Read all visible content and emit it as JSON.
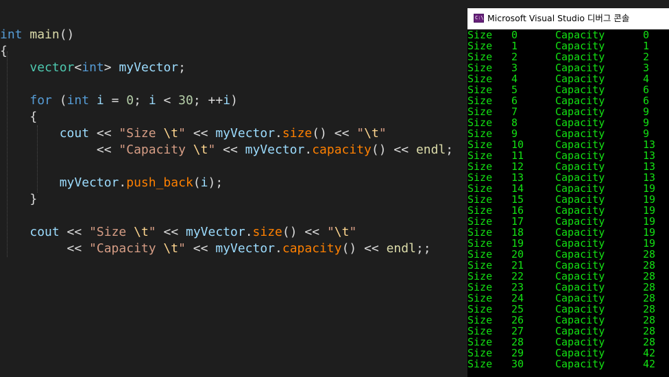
{
  "editor": {
    "lines": [
      [
        {
          "t": "int",
          "c": "kw"
        },
        {
          "t": " ",
          "c": "plain"
        },
        {
          "t": "main",
          "c": "fn"
        },
        {
          "t": "()",
          "c": "plain"
        }
      ],
      [
        {
          "t": "{",
          "c": "plain"
        }
      ],
      [
        {
          "t": "    ",
          "c": "plain"
        },
        {
          "t": "vector",
          "c": "type"
        },
        {
          "t": "<",
          "c": "plain"
        },
        {
          "t": "int",
          "c": "kw"
        },
        {
          "t": "> ",
          "c": "plain"
        },
        {
          "t": "myVector",
          "c": "var"
        },
        {
          "t": ";",
          "c": "plain"
        }
      ],
      [],
      [
        {
          "t": "    ",
          "c": "plain"
        },
        {
          "t": "for",
          "c": "kw"
        },
        {
          "t": " (",
          "c": "plain"
        },
        {
          "t": "int",
          "c": "kw"
        },
        {
          "t": " ",
          "c": "plain"
        },
        {
          "t": "i",
          "c": "var"
        },
        {
          "t": " = ",
          "c": "plain"
        },
        {
          "t": "0",
          "c": "num"
        },
        {
          "t": "; ",
          "c": "plain"
        },
        {
          "t": "i",
          "c": "var"
        },
        {
          "t": " < ",
          "c": "plain"
        },
        {
          "t": "30",
          "c": "num"
        },
        {
          "t": "; ++",
          "c": "plain"
        },
        {
          "t": "i",
          "c": "var"
        },
        {
          "t": ")",
          "c": "plain"
        }
      ],
      [
        {
          "t": "    {",
          "c": "plain"
        }
      ],
      [
        {
          "t": "        ",
          "c": "plain"
        },
        {
          "t": "cout",
          "c": "var"
        },
        {
          "t": " << ",
          "c": "plain"
        },
        {
          "t": "\"Size ",
          "c": "str"
        },
        {
          "t": "\\t",
          "c": "esc"
        },
        {
          "t": "\"",
          "c": "str"
        },
        {
          "t": " << ",
          "c": "plain"
        },
        {
          "t": "myVector",
          "c": "var"
        },
        {
          "t": ".",
          "c": "plain"
        },
        {
          "t": "size",
          "c": "mem"
        },
        {
          "t": "() << ",
          "c": "plain"
        },
        {
          "t": "\"",
          "c": "str"
        },
        {
          "t": "\\t",
          "c": "esc"
        },
        {
          "t": "\"",
          "c": "str"
        }
      ],
      [
        {
          "t": "             << ",
          "c": "plain"
        },
        {
          "t": "\"Capacity ",
          "c": "str"
        },
        {
          "t": "\\t",
          "c": "esc"
        },
        {
          "t": "\"",
          "c": "str"
        },
        {
          "t": " << ",
          "c": "plain"
        },
        {
          "t": "myVector",
          "c": "var"
        },
        {
          "t": ".",
          "c": "plain"
        },
        {
          "t": "capacity",
          "c": "mem"
        },
        {
          "t": "() << ",
          "c": "plain"
        },
        {
          "t": "endl",
          "c": "fn"
        },
        {
          "t": ";",
          "c": "plain"
        }
      ],
      [],
      [
        {
          "t": "        ",
          "c": "plain"
        },
        {
          "t": "myVector",
          "c": "var"
        },
        {
          "t": ".",
          "c": "plain"
        },
        {
          "t": "push_back",
          "c": "mem"
        },
        {
          "t": "(",
          "c": "plain"
        },
        {
          "t": "i",
          "c": "var"
        },
        {
          "t": ");",
          "c": "plain"
        }
      ],
      [
        {
          "t": "    }",
          "c": "plain"
        }
      ],
      [],
      [
        {
          "t": "    ",
          "c": "plain"
        },
        {
          "t": "cout",
          "c": "var"
        },
        {
          "t": " << ",
          "c": "plain"
        },
        {
          "t": "\"Size ",
          "c": "str"
        },
        {
          "t": "\\t",
          "c": "esc"
        },
        {
          "t": "\"",
          "c": "str"
        },
        {
          "t": " << ",
          "c": "plain"
        },
        {
          "t": "myVector",
          "c": "var"
        },
        {
          "t": ".",
          "c": "plain"
        },
        {
          "t": "size",
          "c": "mem"
        },
        {
          "t": "() << ",
          "c": "plain"
        },
        {
          "t": "\"",
          "c": "str"
        },
        {
          "t": "\\t",
          "c": "esc"
        },
        {
          "t": "\"",
          "c": "str"
        }
      ],
      [
        {
          "t": "         << ",
          "c": "plain"
        },
        {
          "t": "\"Capacity ",
          "c": "str"
        },
        {
          "t": "\\t",
          "c": "esc"
        },
        {
          "t": "\"",
          "c": "str"
        },
        {
          "t": " << ",
          "c": "plain"
        },
        {
          "t": "myVector",
          "c": "var"
        },
        {
          "t": ".",
          "c": "plain"
        },
        {
          "t": "capacity",
          "c": "mem"
        },
        {
          "t": "() << ",
          "c": "plain"
        },
        {
          "t": "endl",
          "c": "fn"
        },
        {
          "t": ";;",
          "c": "plain"
        }
      ]
    ]
  },
  "console": {
    "icon_label": "C:\\",
    "title": "Microsoft Visual Studio 디버그 콘솔",
    "size_label": "Size",
    "capacity_label": "Capacity",
    "rows": [
      {
        "size": "0",
        "capacity": "0"
      },
      {
        "size": "1",
        "capacity": "1"
      },
      {
        "size": "2",
        "capacity": "2"
      },
      {
        "size": "3",
        "capacity": "3"
      },
      {
        "size": "4",
        "capacity": "4"
      },
      {
        "size": "5",
        "capacity": "6"
      },
      {
        "size": "6",
        "capacity": "6"
      },
      {
        "size": "7",
        "capacity": "9"
      },
      {
        "size": "8",
        "capacity": "9"
      },
      {
        "size": "9",
        "capacity": "9"
      },
      {
        "size": "10",
        "capacity": "13"
      },
      {
        "size": "11",
        "capacity": "13"
      },
      {
        "size": "12",
        "capacity": "13"
      },
      {
        "size": "13",
        "capacity": "13"
      },
      {
        "size": "14",
        "capacity": "19"
      },
      {
        "size": "15",
        "capacity": "19"
      },
      {
        "size": "16",
        "capacity": "19"
      },
      {
        "size": "17",
        "capacity": "19"
      },
      {
        "size": "18",
        "capacity": "19"
      },
      {
        "size": "19",
        "capacity": "19"
      },
      {
        "size": "20",
        "capacity": "28"
      },
      {
        "size": "21",
        "capacity": "28"
      },
      {
        "size": "22",
        "capacity": "28"
      },
      {
        "size": "23",
        "capacity": "28"
      },
      {
        "size": "24",
        "capacity": "28"
      },
      {
        "size": "25",
        "capacity": "28"
      },
      {
        "size": "26",
        "capacity": "28"
      },
      {
        "size": "27",
        "capacity": "28"
      },
      {
        "size": "28",
        "capacity": "28"
      },
      {
        "size": "29",
        "capacity": "42"
      },
      {
        "size": "30",
        "capacity": "42"
      }
    ]
  }
}
